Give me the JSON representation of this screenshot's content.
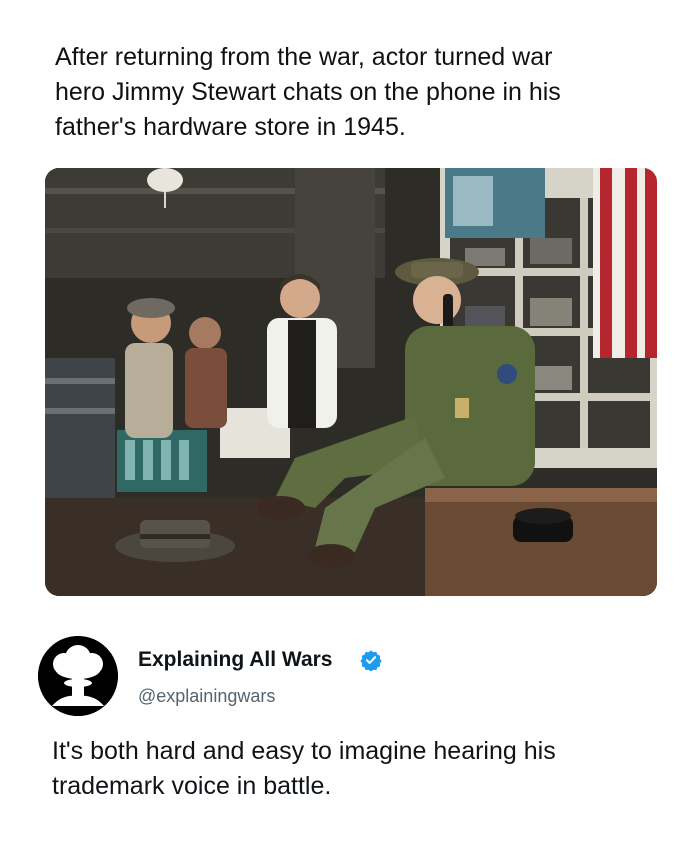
{
  "caption": {
    "line1": "After returning from the war, actor turned war",
    "line2": "hero Jimmy Stewart chats on the phone in his",
    "line3": "father's hardware store in 1945."
  },
  "author": {
    "name": "Explaining All Wars",
    "handle": "@explainingwars"
  },
  "tweet": {
    "line1": "It's both hard and easy to imagine hearing his",
    "line2": "trademark voice in battle."
  },
  "colors": {
    "verified_badge": "#1d9bf0",
    "uniform": "#5a6a3c"
  },
  "icons": {
    "avatar": "mushroom-cloud-icon",
    "verified": "verified-badge-icon"
  }
}
